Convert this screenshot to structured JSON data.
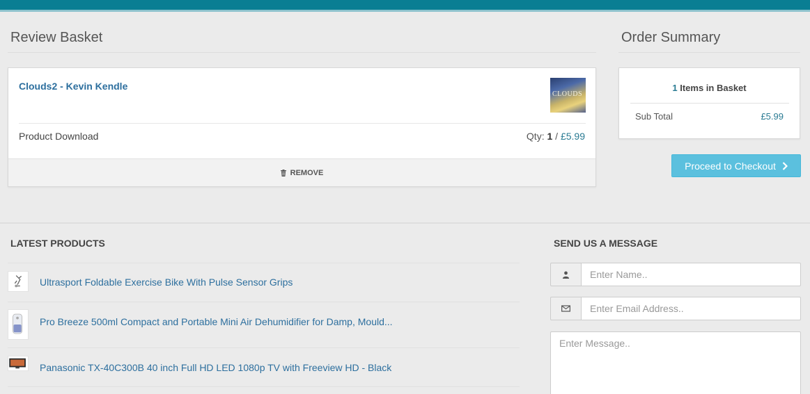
{
  "basket": {
    "heading": "Review Basket",
    "item": {
      "title": "Clouds2 - Kevin Kendle",
      "thumb_text": "CLOUDS",
      "type": "Product Download",
      "qty_label": "Qty:",
      "qty": "1",
      "separator": "/",
      "price": "£5.99",
      "remove_label": "REMOVE"
    }
  },
  "summary": {
    "heading": "Order Summary",
    "item_count": "1",
    "items_label": "Items in Basket",
    "subtotal_label": "Sub Total",
    "subtotal_value": "£5.99",
    "checkout_label": "Proceed to Checkout"
  },
  "latest": {
    "heading": "LATEST PRODUCTS",
    "items": [
      {
        "title": "Ultrasport Foldable Exercise Bike With Pulse Sensor Grips"
      },
      {
        "title": "Pro Breeze 500ml Compact and Portable Mini Air Dehumidifier for Damp, Mould..."
      },
      {
        "title": "Panasonic TX-40C300B 40 inch Full HD LED 1080p TV with Freeview HD - Black"
      }
    ]
  },
  "contact": {
    "heading": "SEND US A MESSAGE",
    "name_placeholder": "Enter Name..",
    "email_placeholder": "Enter Email Address..",
    "message_placeholder": "Enter Message.."
  },
  "colors": {
    "topbar": "#0a7e93",
    "link": "#2d6f9e",
    "price": "#2a7b93",
    "checkout_button": "#5bc0de"
  }
}
